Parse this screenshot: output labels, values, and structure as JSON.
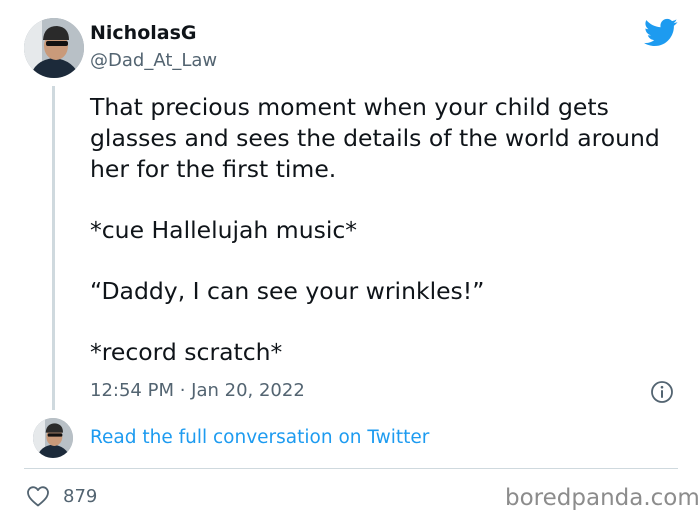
{
  "author": {
    "name": "NicholasG",
    "handle": "@Dad_At_Law"
  },
  "tweet": {
    "paragraphs": [
      "That precious moment when your child gets glasses and sees the details of the world around her for the first time.",
      "*cue Hallelujah music*",
      "“Daddy, I can see your wrinkles!”",
      "*record scratch*"
    ],
    "timestamp": "12:54 PM · Jan 20, 2022"
  },
  "thread": {
    "link_text": "Read the full conversation on Twitter"
  },
  "actions": {
    "like_count": "879"
  },
  "watermark": "boredpanda.com",
  "colors": {
    "twitter_blue": "#1d9bf0",
    "secondary_text": "#536471",
    "divider": "#cfd9de"
  },
  "icons": [
    "twitter-bird-icon",
    "info-icon",
    "heart-icon"
  ]
}
